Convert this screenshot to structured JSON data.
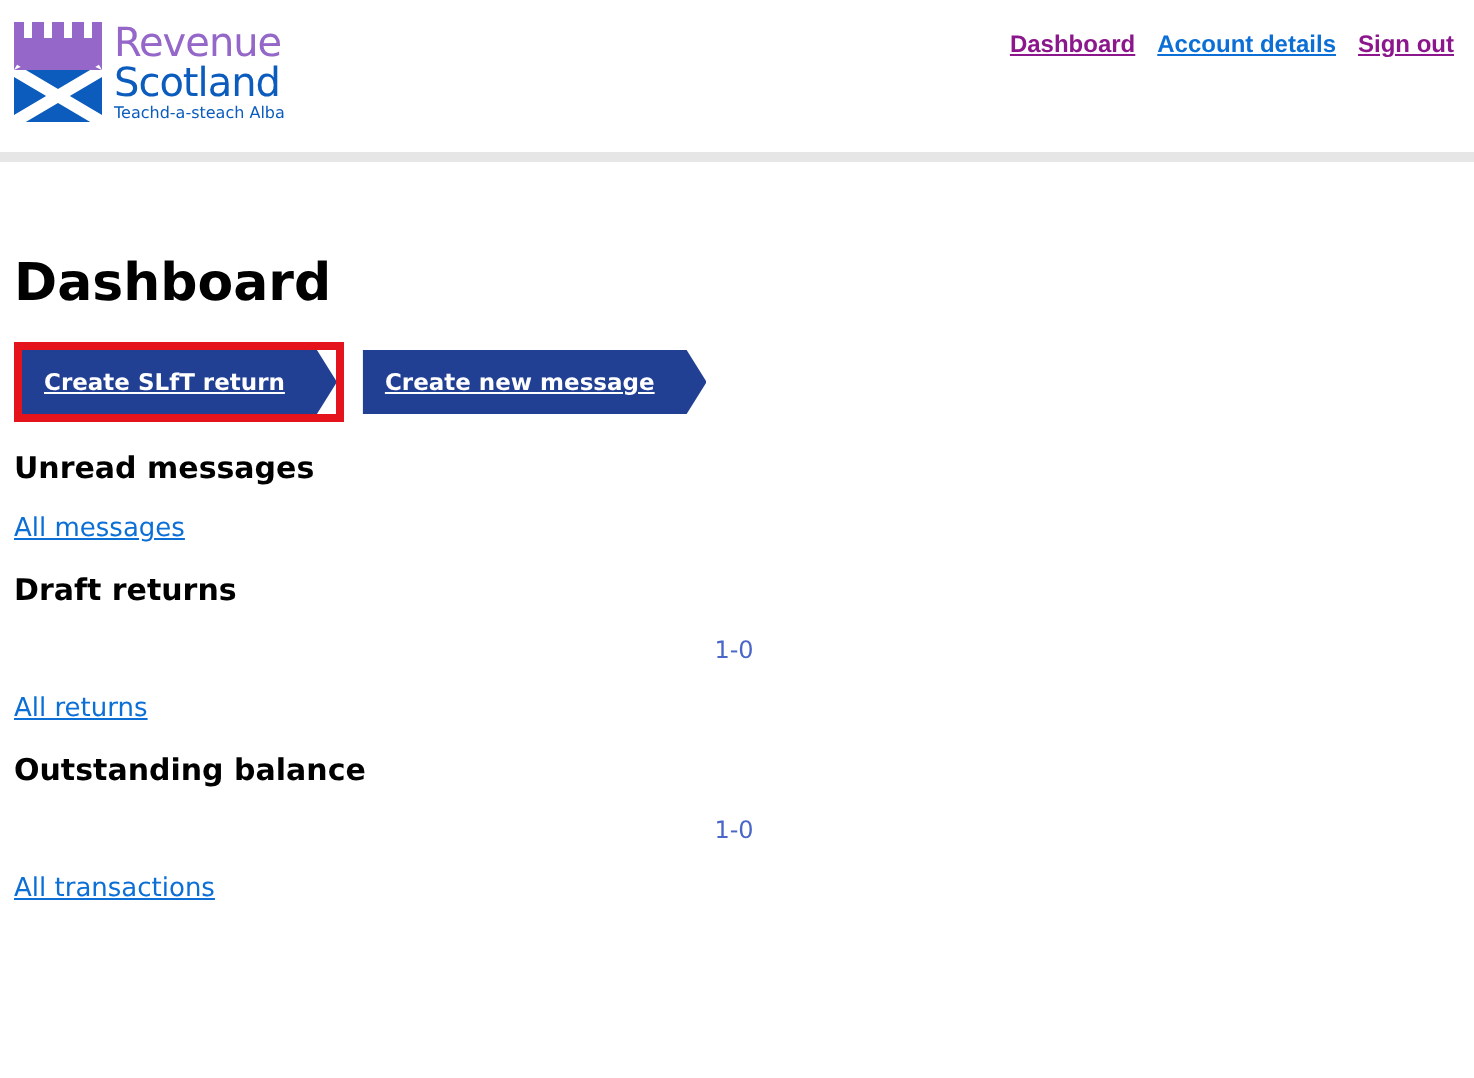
{
  "logo": {
    "line_1": "Revenue",
    "line_2": "Scotland",
    "tagline": "Teachd-a-steach Alba"
  },
  "nav": [
    {
      "label": "Dashboard",
      "visited": true
    },
    {
      "label": "Account details",
      "visited": false
    },
    {
      "label": "Sign out",
      "visited": true
    }
  ],
  "title": "Dashboard",
  "actions": [
    {
      "label": "Create SLfT return",
      "highlighted": true
    },
    {
      "label": "Create new message",
      "highlighted": false
    }
  ],
  "sections": [
    {
      "heading": "Unread messages",
      "link": "All messages"
    },
    {
      "heading": "Draft returns",
      "pagination": "1-0",
      "link": "All returns"
    },
    {
      "heading": "Outstanding balance",
      "pagination": "1-0",
      "link": "All transactions"
    }
  ]
}
